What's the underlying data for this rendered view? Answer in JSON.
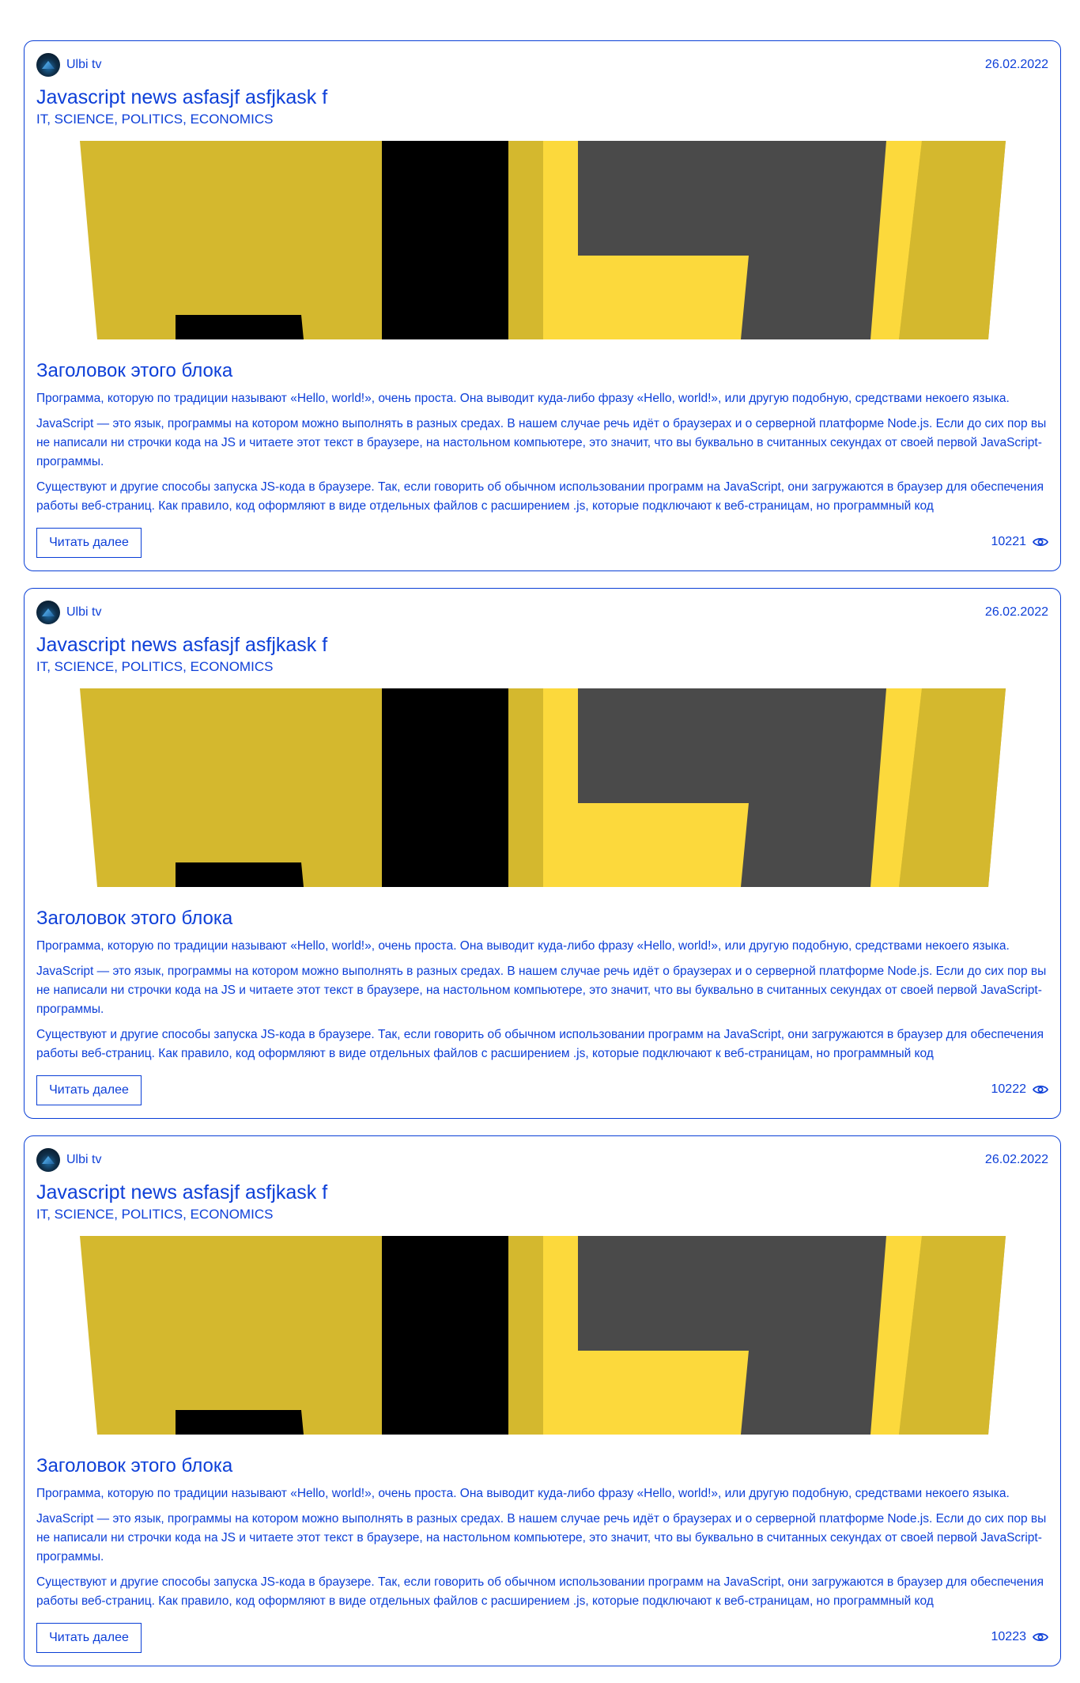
{
  "posts": [
    {
      "author": "Ulbi tv",
      "date": "26.02.2022",
      "title": "Javascript news asfasjf asfjkask f",
      "tags": "IT, SCIENCE, POLITICS, ECONOMICS",
      "block_title": "Заголовок этого блока",
      "paragraphs": [
        "Программа, которую по традиции называют «Hello, world!», очень проста. Она выводит куда-либо фразу «Hello, world!», или другую подобную, средствами некоего языка.",
        "JavaScript — это язык, программы на котором можно выполнять в разных средах. В нашем случае речь идёт о браузерах и о серверной платформе Node.js. Если до сих пор вы не написали ни строчки кода на JS и читаете этот текст в браузере, на настольном компьютере, это значит, что вы буквально в считанных секундах от своей первой JavaScript-программы.",
        "Существуют и другие способы запуска JS-кода в браузере. Так, если говорить об обычном использовании программ на JavaScript, они загружаются в браузер для обеспечения работы веб-страниц. Как правило, код оформляют в виде отдельных файлов с расширением .js, которые подключают к веб-страницам, но программный код"
      ],
      "read_more": "Читать далее",
      "views": "10221"
    },
    {
      "author": "Ulbi tv",
      "date": "26.02.2022",
      "title": "Javascript news asfasjf asfjkask f",
      "tags": "IT, SCIENCE, POLITICS, ECONOMICS",
      "block_title": "Заголовок этого блока",
      "paragraphs": [
        "Программа, которую по традиции называют «Hello, world!», очень проста. Она выводит куда-либо фразу «Hello, world!», или другую подобную, средствами некоего языка.",
        "JavaScript — это язык, программы на котором можно выполнять в разных средах. В нашем случае речь идёт о браузерах и о серверной платформе Node.js. Если до сих пор вы не написали ни строчки кода на JS и читаете этот текст в браузере, на настольном компьютере, это значит, что вы буквально в считанных секундах от своей первой JavaScript-программы.",
        "Существуют и другие способы запуска JS-кода в браузере. Так, если говорить об обычном использовании программ на JavaScript, они загружаются в браузер для обеспечения работы веб-страниц. Как правило, код оформляют в виде отдельных файлов с расширением .js, которые подключают к веб-страницам, но программный код"
      ],
      "read_more": "Читать далее",
      "views": "10222"
    },
    {
      "author": "Ulbi tv",
      "date": "26.02.2022",
      "title": "Javascript news asfasjf asfjkask f",
      "tags": "IT, SCIENCE, POLITICS, ECONOMICS",
      "block_title": "Заголовок этого блока",
      "paragraphs": [
        "Программа, которую по традиции называют «Hello, world!», очень проста. Она выводит куда-либо фразу «Hello, world!», или другую подобную, средствами некоего языка.",
        "JavaScript — это язык, программы на котором можно выполнять в разных средах. В нашем случае речь идёт о браузерах и о серверной платформе Node.js. Если до сих пор вы не написали ни строчки кода на JS и читаете этот текст в браузере, на настольном компьютере, это значит, что вы буквально в считанных секундах от своей первой JavaScript-программы.",
        "Существуют и другие способы запуска JS-кода в браузере. Так, если говорить об обычном использовании программ на JavaScript, они загружаются в браузер для обеспечения работы веб-страниц. Как правило, код оформляют в виде отдельных файлов с расширением .js, которые подключают к веб-страницам, но программный код"
      ],
      "read_more": "Читать далее",
      "views": "10223"
    }
  ],
  "icons": {
    "views": "eye-icon",
    "avatar": "avatar-image"
  },
  "colors": {
    "accent": "#0d3fd8",
    "js_yellow_dark": "#d4b82e",
    "js_yellow": "#fcd93c",
    "js_black": "#000000",
    "js_gray": "#4a4a4a"
  }
}
